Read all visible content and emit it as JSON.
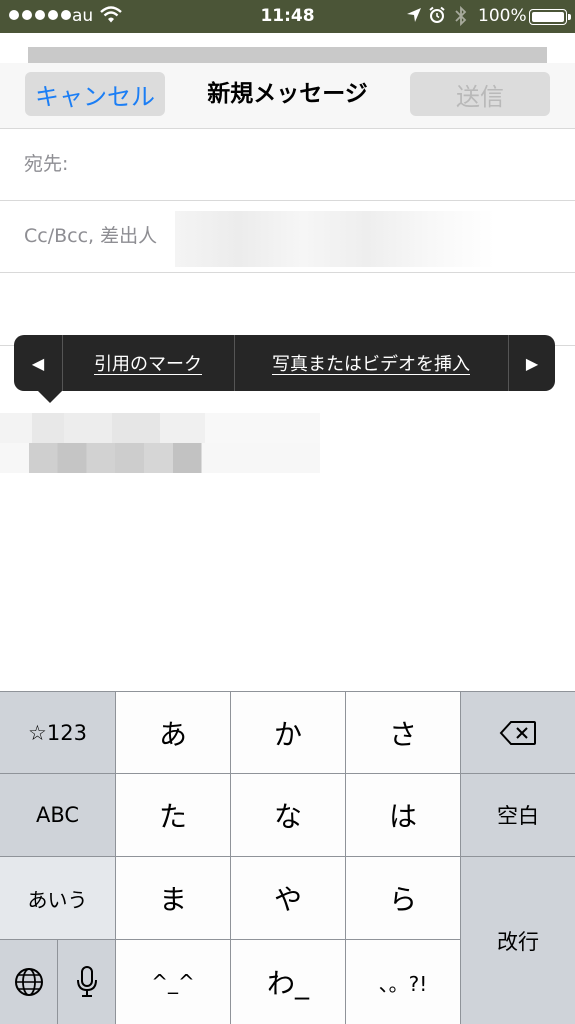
{
  "status_bar": {
    "carrier": "au",
    "time": "11:48",
    "battery": "100%"
  },
  "nav": {
    "cancel_label": "キャンセル",
    "title": "新規メッセージ",
    "send_label": "送信"
  },
  "fields": {
    "to_label": "宛先:",
    "cc_label": "Cc/Bcc, 差出人"
  },
  "edit_menu": {
    "items": [
      "引用のマーク",
      "写真またはビデオを挿入"
    ],
    "left_arrow": "◀",
    "right_arrow": "▶"
  },
  "keyboard": {
    "rows": [
      [
        "☆123",
        "あ",
        "か",
        "さ",
        "⌫"
      ],
      [
        "ABC",
        "た",
        "な",
        "は",
        "空白"
      ],
      [
        "あいう",
        "ま",
        "や",
        "ら",
        "改行"
      ],
      [
        "🌐",
        "🎤",
        "^_^",
        "わ",
        "、。?!"
      ]
    ],
    "labels": {
      "num": "☆123",
      "abc": "ABC",
      "kana": "あいう",
      "space": "空白",
      "enter": "改行",
      "a": "あ",
      "ka": "か",
      "sa": "さ",
      "ta": "た",
      "na": "な",
      "ha": "は",
      "ma": "ま",
      "ya": "や",
      "ra": "ら",
      "emoticon": "^_^",
      "wa": "わ_",
      "punct": "、。?!"
    }
  }
}
